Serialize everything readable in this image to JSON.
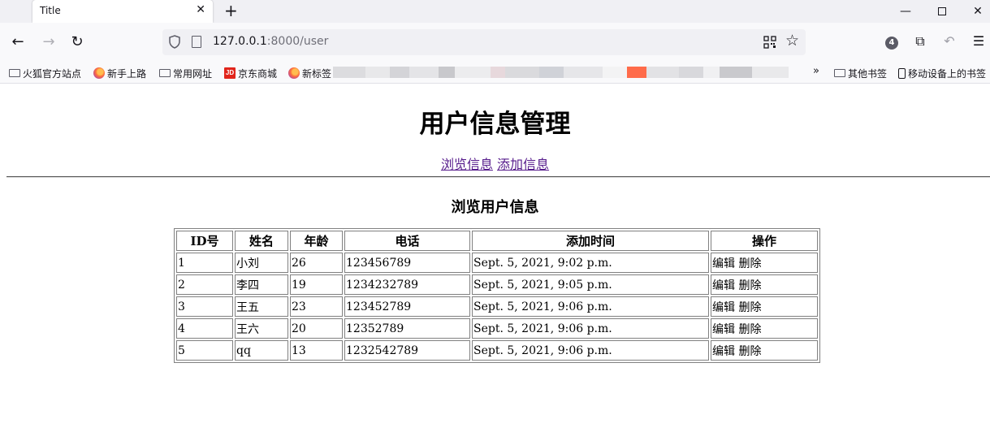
{
  "browser": {
    "tab_title": "Title",
    "url_host": "127.0.0.1",
    "url_rest": ":8000/user",
    "extension_badge": "4"
  },
  "bookmarks": [
    {
      "label": "火狐官方站点",
      "icon": "folder-icon"
    },
    {
      "label": "新手上路",
      "icon": "firefox-icon"
    },
    {
      "label": "常用网址",
      "icon": "folder-icon"
    },
    {
      "label": "京东商城",
      "icon": "jd-icon"
    },
    {
      "label": "新标签",
      "icon": "firefox-icon"
    }
  ],
  "bookmarks_right": [
    {
      "label": "其他书签",
      "icon": "folder-icon"
    },
    {
      "label": "移动设备上的书签",
      "icon": "mobile-icon"
    }
  ],
  "page": {
    "title": "用户信息管理",
    "links": [
      "浏览信息",
      "添加信息"
    ],
    "section_title": "浏览用户信息"
  },
  "table": {
    "headers": [
      "ID号",
      "姓名",
      "年龄",
      "电话",
      "添加时间",
      "操作"
    ],
    "rows": [
      {
        "id": "1",
        "name": "小刘",
        "age": "26",
        "phone": "123456789",
        "time": "Sept. 5, 2021, 9:02 p.m.",
        "edit": "编辑",
        "delete": "删除"
      },
      {
        "id": "2",
        "name": "李四",
        "age": "19",
        "phone": "1234232789",
        "time": "Sept. 5, 2021, 9:05 p.m.",
        "edit": "编辑",
        "delete": "删除"
      },
      {
        "id": "3",
        "name": "王五",
        "age": "23",
        "phone": "123452789",
        "time": "Sept. 5, 2021, 9:06 p.m.",
        "edit": "编辑",
        "delete": "删除"
      },
      {
        "id": "4",
        "name": "王六",
        "age": "20",
        "phone": "12352789",
        "time": "Sept. 5, 2021, 9:06 p.m.",
        "edit": "编辑",
        "delete": "删除"
      },
      {
        "id": "5",
        "name": "qq",
        "age": "13",
        "phone": "1232542789",
        "time": "Sept. 5, 2021, 9:06 p.m.",
        "edit": "编辑",
        "delete": "删除"
      }
    ]
  },
  "colors": {
    "visited_link": "#551a8b",
    "toolbar_bg": "#f9f9fb",
    "tabstrip_bg": "#f0f0f4"
  }
}
